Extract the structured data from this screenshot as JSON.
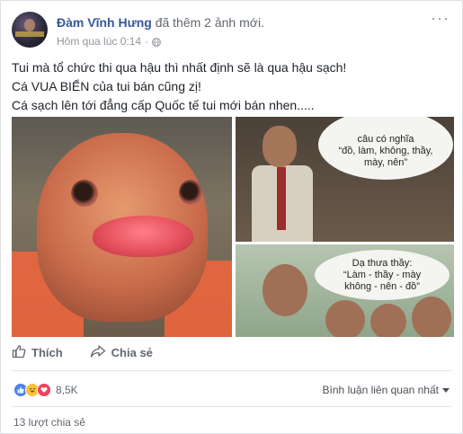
{
  "post": {
    "author": "Đàm Vĩnh Hưng",
    "action": "đã thêm 2 ảnh mới.",
    "timestamp": "Hôm qua lúc 0:14",
    "separator": "·",
    "more": "···",
    "text_lines": [
      "Tui mà tổ chức thi qua hậu thì nhất định sẽ là qua hậu sạch!",
      "Cá VUA BIỂN của tui bán cũng zị!",
      "Cá sạch lên tới đẳng cấp Quốc tế tui mới bán nhen....."
    ]
  },
  "photos": {
    "right_top_caption_lines": [
      "câu có nghĩa",
      "“đồ, làm, không, thầy,",
      "mày, nên”"
    ],
    "right_bottom_caption_lines": [
      "Dạ thưa thầy:",
      "“Làm - thầy - mày",
      "không - nên - đồ”"
    ]
  },
  "actions": {
    "like_label": "Thích",
    "share_label": "Chia sẻ"
  },
  "reactions": {
    "count": "8,5K",
    "types": [
      "like-icon",
      "haha-icon",
      "love-icon"
    ]
  },
  "comments": {
    "sort_label": "Bình luận liên quan nhất"
  },
  "shares": {
    "label": "13 lượt chia sẻ"
  },
  "colors": {
    "link": "#365899",
    "muted": "#90949c",
    "text": "#1d2129",
    "like": "#4e81f0",
    "haha": "#f7c33b",
    "love": "#f0425a"
  }
}
